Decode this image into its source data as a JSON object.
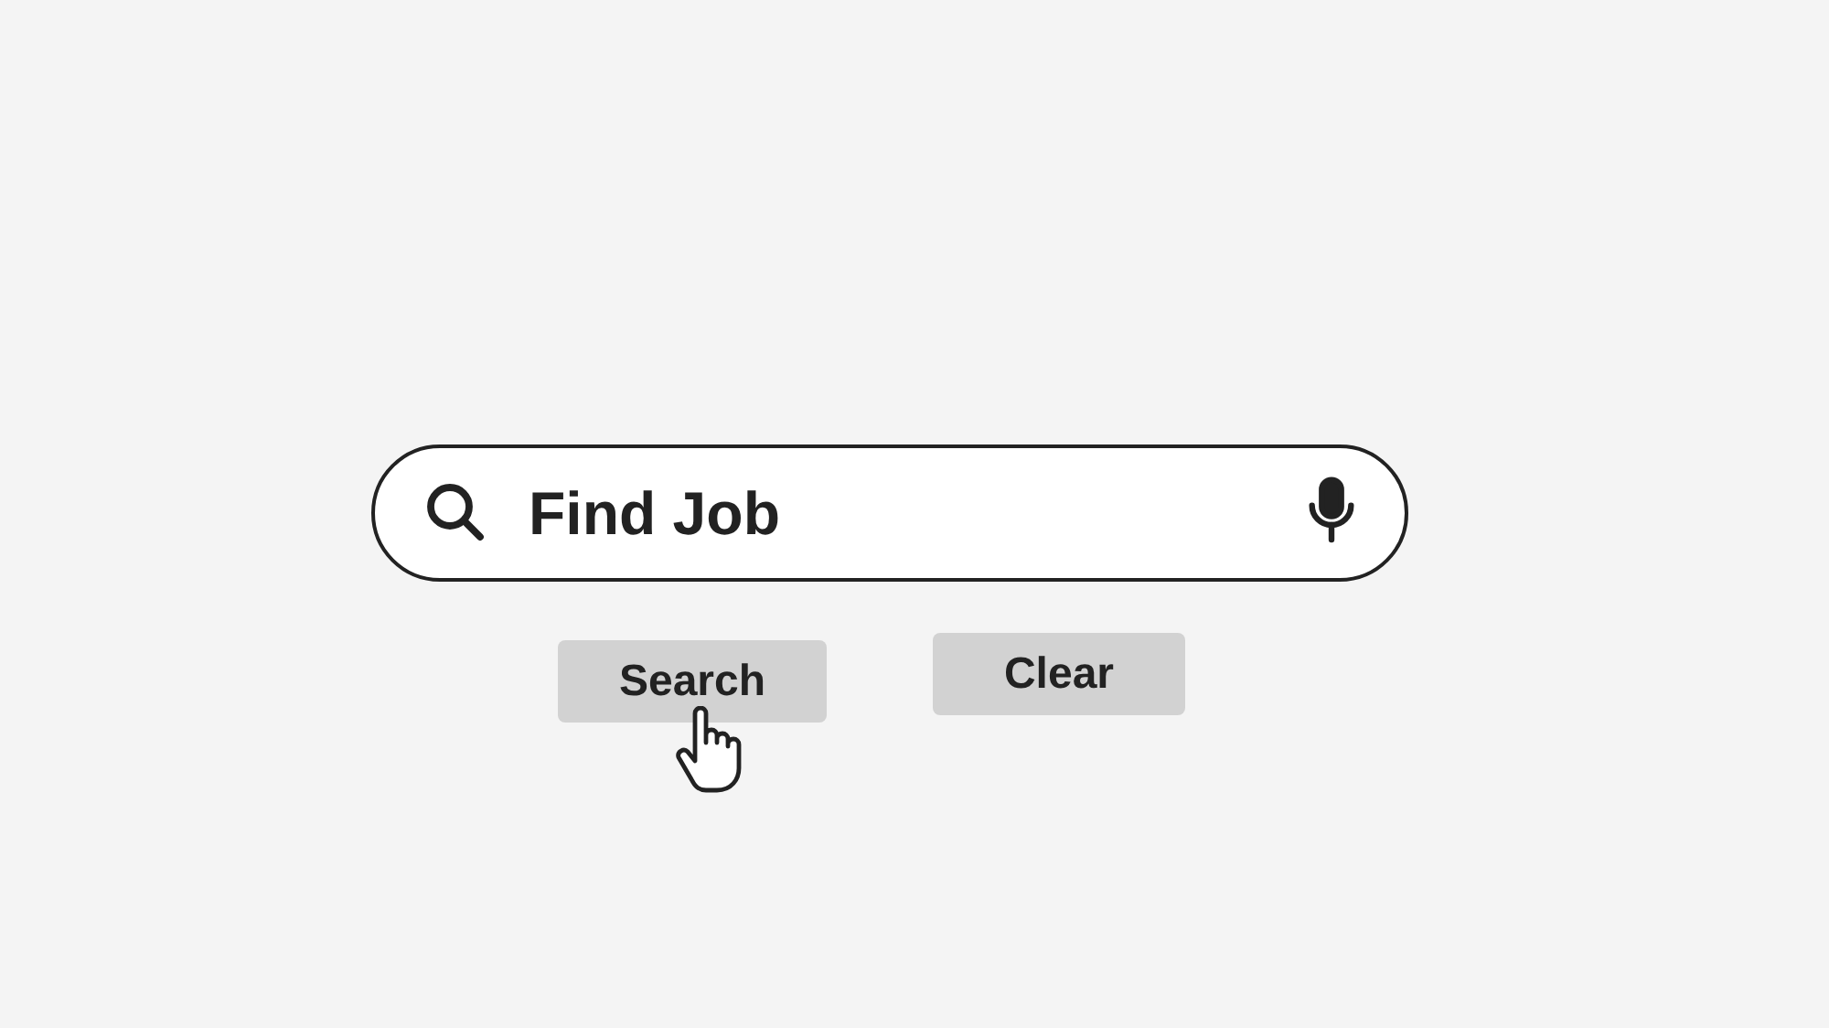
{
  "search": {
    "value": "Find Job"
  },
  "buttons": [
    {
      "label": "Search"
    },
    {
      "label": "Clear"
    }
  ]
}
